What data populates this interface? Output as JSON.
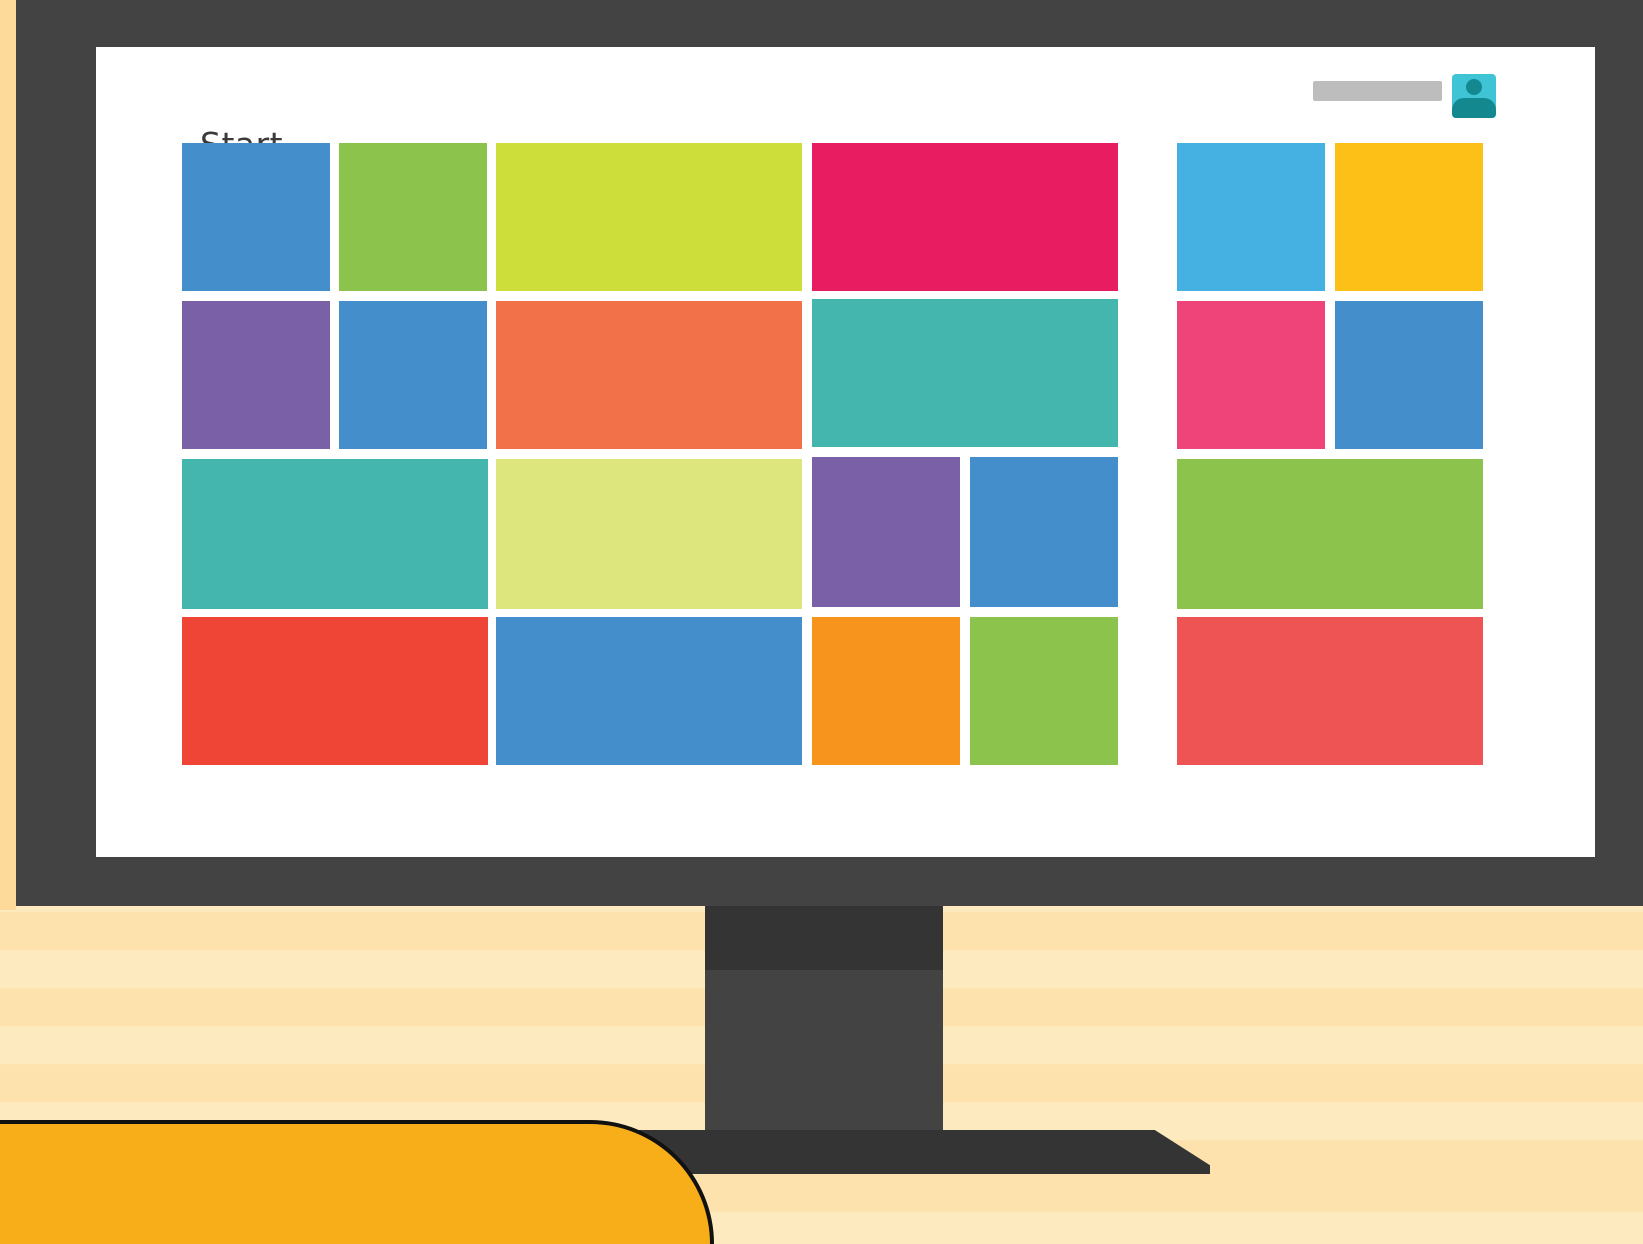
{
  "screen": {
    "title": "Start",
    "user_avatar_icon": "user-icon"
  },
  "tile_colors": {
    "blue": "#448ecb",
    "green": "#8bc34d",
    "lime": "#cddd3a",
    "magenta": "#e81d61",
    "purple": "#7a60a7",
    "orange": "#f37149",
    "teal": "#44b6ad",
    "pale_lime": "#dde57d",
    "red": "#ef4537",
    "amber": "#f7941e",
    "sky": "#44b1e2",
    "yellow": "#fdc016",
    "pink": "#ef447a",
    "coral": "#ee5454"
  },
  "tiles": [
    {
      "id": "tile-1",
      "color": "blue"
    },
    {
      "id": "tile-2",
      "color": "green"
    },
    {
      "id": "tile-3",
      "color": "lime"
    },
    {
      "id": "tile-4",
      "color": "magenta"
    },
    {
      "id": "tile-5",
      "color": "purple"
    },
    {
      "id": "tile-6",
      "color": "blue"
    },
    {
      "id": "tile-7",
      "color": "orange"
    },
    {
      "id": "tile-8",
      "color": "teal"
    },
    {
      "id": "tile-9",
      "color": "teal"
    },
    {
      "id": "tile-10",
      "color": "pale_lime"
    },
    {
      "id": "tile-11",
      "color": "purple"
    },
    {
      "id": "tile-12",
      "color": "blue"
    },
    {
      "id": "tile-13",
      "color": "red"
    },
    {
      "id": "tile-14",
      "color": "blue"
    },
    {
      "id": "tile-15",
      "color": "amber"
    },
    {
      "id": "tile-16",
      "color": "green"
    },
    {
      "id": "tile-17",
      "color": "sky"
    },
    {
      "id": "tile-18",
      "color": "yellow"
    },
    {
      "id": "tile-19",
      "color": "pink"
    },
    {
      "id": "tile-20",
      "color": "blue"
    },
    {
      "id": "tile-21",
      "color": "green"
    },
    {
      "id": "tile-22",
      "color": "coral"
    }
  ]
}
